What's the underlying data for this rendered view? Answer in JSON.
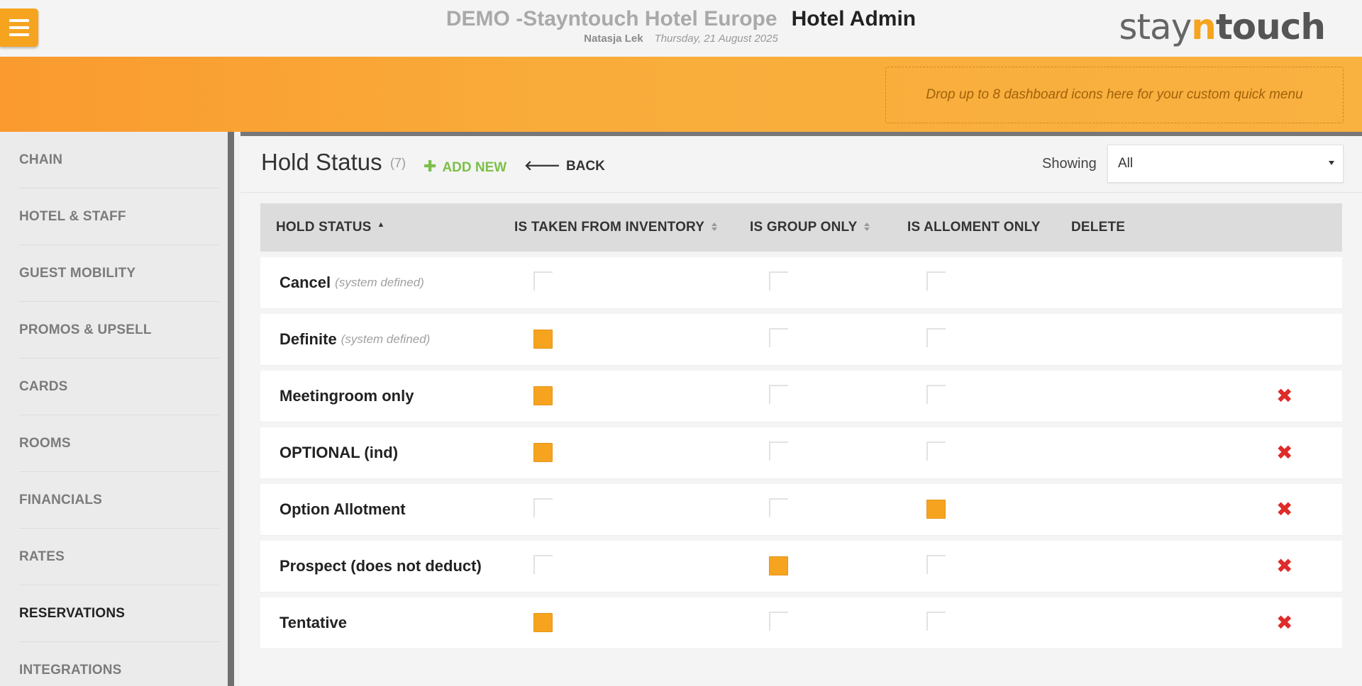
{
  "header": {
    "hotel_name": "DEMO -Stayntouch Hotel Europe",
    "app_title": "Hotel Admin",
    "user_name": "Natasja Lek",
    "date": "Thursday, 21 August 2025",
    "logo": {
      "part1": "stay",
      "part2": "n",
      "part3": "touch"
    }
  },
  "quick_menu": {
    "placeholder": "Drop up to 8 dashboard icons here for your custom quick menu"
  },
  "sidebar": {
    "items": [
      {
        "label": "CHAIN",
        "active": false
      },
      {
        "label": "HOTEL & STAFF",
        "active": false
      },
      {
        "label": "GUEST MOBILITY",
        "active": false
      },
      {
        "label": "PROMOS & UPSELL",
        "active": false
      },
      {
        "label": "CARDS",
        "active": false
      },
      {
        "label": "ROOMS",
        "active": false
      },
      {
        "label": "FINANCIALS",
        "active": false
      },
      {
        "label": "RATES",
        "active": false
      },
      {
        "label": "RESERVATIONS",
        "active": true
      },
      {
        "label": "INTEGRATIONS",
        "active": false
      }
    ]
  },
  "main": {
    "title": "Hold Status",
    "count": "(7)",
    "add_new_label": "ADD NEW",
    "back_label": "BACK",
    "showing_label": "Showing",
    "showing_value": "All"
  },
  "table": {
    "columns": [
      "HOLD STATUS",
      "IS TAKEN FROM INVENTORY",
      "IS GROUP ONLY",
      "IS ALLOMENT ONLY",
      "DELETE"
    ],
    "rows": [
      {
        "name": "Cancel",
        "note": "(system defined)",
        "inventory": false,
        "group": false,
        "allotment": false,
        "deletable": false
      },
      {
        "name": "Definite",
        "note": "(system defined)",
        "inventory": true,
        "group": false,
        "allotment": false,
        "deletable": false
      },
      {
        "name": "Meetingroom only",
        "note": "",
        "inventory": true,
        "group": false,
        "allotment": false,
        "deletable": true
      },
      {
        "name": "OPTIONAL (ind)",
        "note": "",
        "inventory": true,
        "group": false,
        "allotment": false,
        "deletable": true
      },
      {
        "name": "Option Allotment",
        "note": "",
        "inventory": false,
        "group": false,
        "allotment": true,
        "deletable": true
      },
      {
        "name": "Prospect (does not deduct)",
        "note": "",
        "inventory": false,
        "group": true,
        "allotment": false,
        "deletable": true
      },
      {
        "name": "Tentative",
        "note": "",
        "inventory": true,
        "group": false,
        "allotment": false,
        "deletable": true
      }
    ]
  },
  "icons": {
    "menu": "hamburger-icon",
    "add": "plus-icon",
    "back": "arrow-left-icon",
    "delete": "close-x-icon",
    "sort": "sort-icon"
  },
  "colors": {
    "accent": "#f6a41f",
    "delete": "#e02b2b",
    "add": "#7cbf4a"
  }
}
